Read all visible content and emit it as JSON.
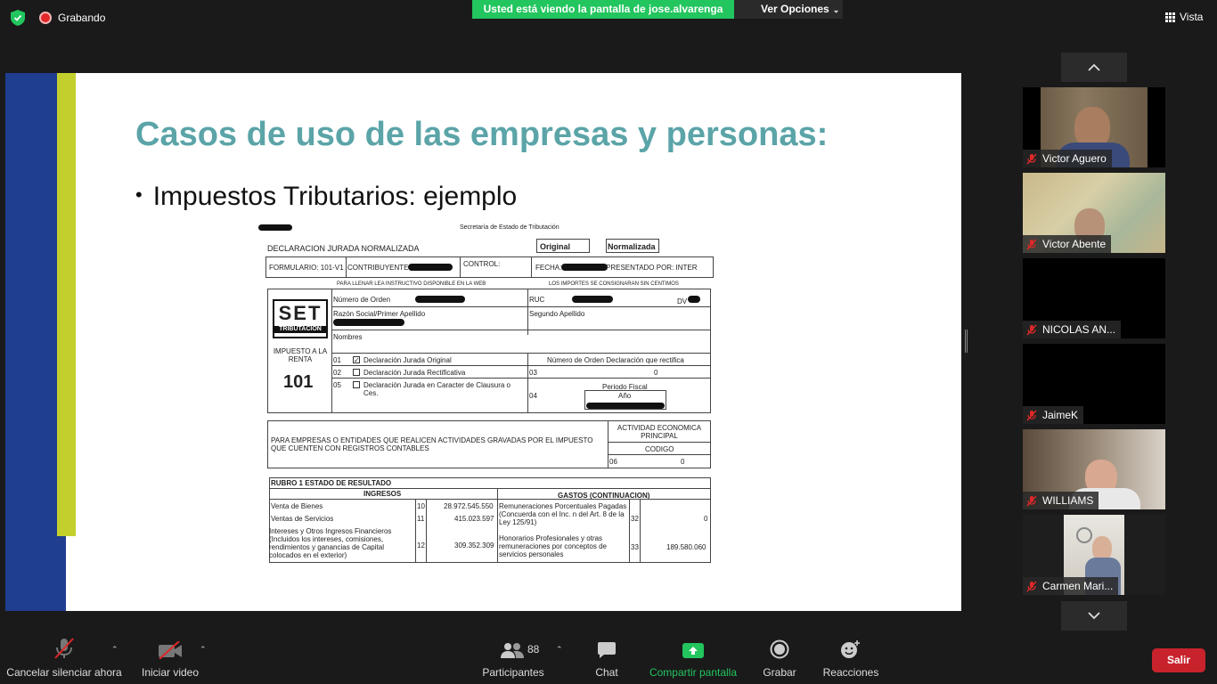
{
  "topbar": {
    "recording_label": "Grabando",
    "sharing_banner": "Usted está viendo la pantalla de jose.alvarenga",
    "view_options_label": "Ver Opciones",
    "view_label": "Vista"
  },
  "slide": {
    "title": "Casos de uso de las empresas y personas:",
    "bullet": "Impuestos Tributarios: ejemplo",
    "form": {
      "header": "Secretaría de Estado de Tributación",
      "declaracion": "DECLARACION JURADA NORMALIZADA",
      "original": "Original",
      "normalizada": "Normalizada",
      "formulario": "FORMULARIO: 101-V1",
      "contribuyente": "CONTRIBUYENTE",
      "control": "CONTROL:",
      "fecha": "FECHA:",
      "presentado": "PRESENTADO POR: INTER",
      "instructivo": "PARA LLENAR LEA INSTRUCTIVO DISPONIBLE EN LA WEB",
      "importes": "LOS IMPORTES SE CONSIGNARAN SIN CENTIMOS",
      "numero_orden": "Número de Orden",
      "ruc": "RUC",
      "dv": "DV",
      "razon_social": "Razón Social/Primer Apellido",
      "segundo_apellido": "Segundo Apellido",
      "nombres": "Nombres",
      "logo": "SET",
      "logo_sub": "TRIBUTACION",
      "impuesto": "IMPUESTO A LA RENTA",
      "impuesto_num": "101",
      "row_01": "01",
      "row_02": "02",
      "row_05": "05",
      "row_03": "03",
      "row_04": "04",
      "opt_original": "Declaración Jurada Original",
      "opt_rectificativa": "Declaración Jurada Rectificativa",
      "opt_clausura": "Declaración Jurada en Caracter de Clausura o Ces.",
      "num_orden_rectifica": "Número de Orden Declaración que rectifica",
      "zero": "0",
      "periodo": "Periodo Fiscal",
      "anio": "Año",
      "empresas": "PARA EMPRESAS O ENTIDADES QUE REALICEN ACTIVIDADES GRAVADAS POR EL IMPUESTO QUE CUENTEN CON REGISTROS CONTABLES",
      "actividad": "ACTIVIDAD ECONOMICA PRINCIPAL",
      "codigo": "CODIGO",
      "row_06": "06",
      "rubro": "RUBRO 1 ESTADO DE RESULTADO",
      "ingresos": "INGRESOS",
      "gastos": "GASTOS (CONTINUACION)",
      "venta_bienes": "Venta de Bienes",
      "venta_servicios": "Ventas de Servicios",
      "intereses": "Intereses y Otros Ingresos Financieros (Incluidos los intereses, comisiones, rendimientos y ganancias de Capital colocados en el exterior)",
      "row_10": "10",
      "row_11": "11",
      "row_12": "12",
      "val_10": "28.972.545.550",
      "val_11": "415.023.597",
      "val_12": "309.352.309",
      "remuneraciones": "Remuneraciones Porcentuales Pagadas (Concuerda con el Inc. n del Art. 8 de la Ley 125/91)",
      "honorarios": "Honorarios Profesionales y otras remuneraciones por conceptos de servicios personales",
      "row_32": "32",
      "row_33": "33",
      "val_32": "0",
      "val_33": "189.580.060"
    }
  },
  "participants": [
    {
      "name": "Victor Aguero"
    },
    {
      "name": "Victor Abente"
    },
    {
      "name": "NICOLAS AN..."
    },
    {
      "name": "JaimeK"
    },
    {
      "name": "WILLIAMS"
    },
    {
      "name": "Carmen Mari..."
    }
  ],
  "toolbar": {
    "mute_label": "Cancelar silenciar ahora",
    "video_label": "Iniciar video",
    "participants_label": "Participantes",
    "participants_count": "88",
    "chat_label": "Chat",
    "share_label": "Compartir pantalla",
    "record_label": "Grabar",
    "reactions_label": "Reacciones",
    "leave_label": "Salir"
  },
  "colors": {
    "share_green": "#22c55e",
    "leave_red": "#c8232c",
    "slide_title": "#5ba4a8",
    "slide_blue_bar": "#1f3e8f",
    "slide_lime_bar": "#c3cf2c"
  }
}
